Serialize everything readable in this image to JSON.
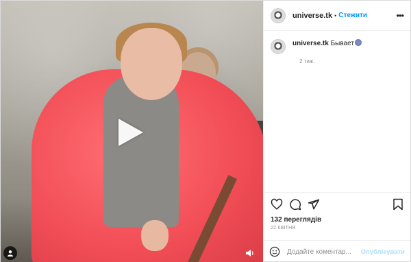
{
  "post": {
    "username": "universe.tk",
    "follow_label": "Стежити",
    "more_label": "•••",
    "caption_user": "universe.tk",
    "caption_text": " Бывает",
    "caption_time": "2 тиж.",
    "views": "132 переглядів",
    "date": "22 КВІТНЯ"
  },
  "comment": {
    "placeholder": "Додайте коментар...",
    "publish_label": "Опублікувати"
  },
  "icons": {
    "play": "play-icon",
    "user_tag": "user-tag-icon",
    "sound": "sound-icon",
    "like": "heart-icon",
    "comment": "comment-icon",
    "share": "share-icon",
    "save": "bookmark-icon",
    "emoji": "smile-icon"
  },
  "colors": {
    "link": "#0095f6",
    "publish_disabled": "#b2dffc",
    "muted": "#8e8e8e"
  }
}
